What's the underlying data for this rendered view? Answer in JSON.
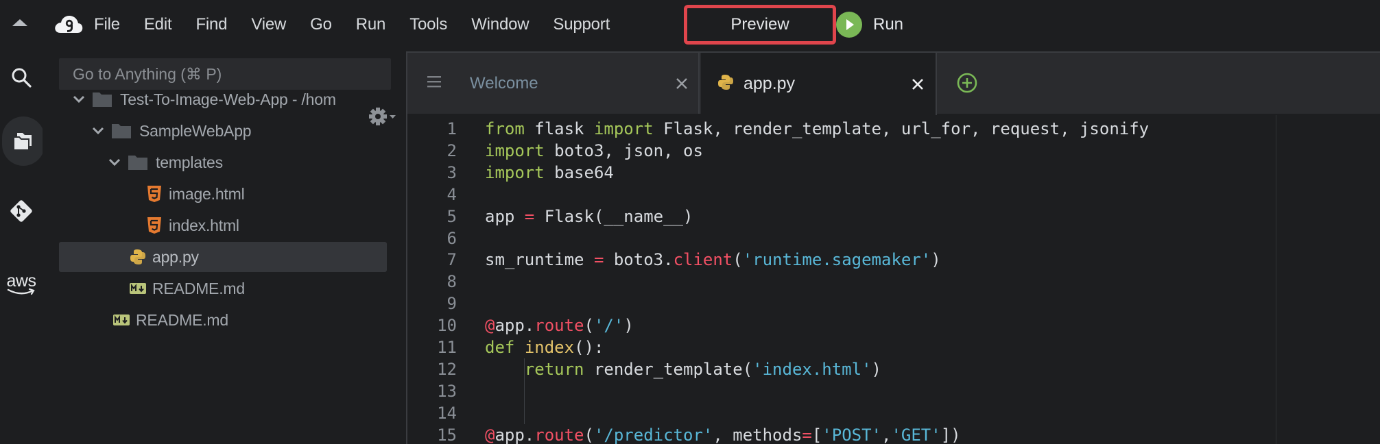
{
  "menubar": {
    "items": [
      "File",
      "Edit",
      "Find",
      "View",
      "Go",
      "Run",
      "Tools",
      "Window",
      "Support"
    ],
    "preview_label": "Preview",
    "run_label": "Run"
  },
  "rail": {
    "icons": [
      "search-icon",
      "files-icon",
      "git-icon",
      "aws-icon"
    ],
    "aws_text": "aws"
  },
  "tree": {
    "goto_placeholder": "Go to Anything (⌘ P)",
    "items": [
      {
        "label": "Test-To-Image-Web-App - /hom",
        "kind": "folder",
        "level": 0
      },
      {
        "label": "SampleWebApp",
        "kind": "folder",
        "level": 1
      },
      {
        "label": "templates",
        "kind": "folder",
        "level": 2
      },
      {
        "label": "image.html",
        "kind": "html",
        "level": 3
      },
      {
        "label": "index.html",
        "kind": "html",
        "level": 3
      },
      {
        "label": "app.py",
        "kind": "python",
        "level": 2,
        "selected": true
      },
      {
        "label": "README.md",
        "kind": "markdown",
        "level": 2
      },
      {
        "label": "README.md",
        "kind": "markdown",
        "level": 1
      }
    ]
  },
  "editor": {
    "tabs": [
      {
        "label": "Welcome",
        "active": false
      },
      {
        "label": "app.py",
        "active": true
      }
    ],
    "lines": [
      {
        "n": "1",
        "tokens": [
          [
            "kw",
            "from"
          ],
          [
            "plain",
            " flask "
          ],
          [
            "kw",
            "import"
          ],
          [
            "plain",
            " Flask, render_template, url_for, request, jsonify"
          ]
        ]
      },
      {
        "n": "2",
        "tokens": [
          [
            "kw",
            "import"
          ],
          [
            "plain",
            " boto3, json, os"
          ]
        ]
      },
      {
        "n": "3",
        "tokens": [
          [
            "kw",
            "import"
          ],
          [
            "plain",
            " base64"
          ]
        ]
      },
      {
        "n": "4",
        "tokens": []
      },
      {
        "n": "5",
        "tokens": [
          [
            "plain",
            "app "
          ],
          [
            "op",
            "="
          ],
          [
            "plain",
            " Flask(__name__)"
          ]
        ]
      },
      {
        "n": "6",
        "tokens": []
      },
      {
        "n": "7",
        "tokens": [
          [
            "plain",
            "sm_runtime "
          ],
          [
            "op",
            "="
          ],
          [
            "plain",
            " boto3."
          ],
          [
            "meth",
            "client"
          ],
          [
            "plain",
            "("
          ],
          [
            "str",
            "'runtime.sagemaker'"
          ],
          [
            "plain",
            ")"
          ]
        ]
      },
      {
        "n": "8",
        "tokens": []
      },
      {
        "n": "9",
        "tokens": []
      },
      {
        "n": "10",
        "tokens": [
          [
            "at",
            "@"
          ],
          [
            "plain",
            "app."
          ],
          [
            "meth",
            "route"
          ],
          [
            "plain",
            "("
          ],
          [
            "str",
            "'/'"
          ],
          [
            "plain",
            ")"
          ]
        ]
      },
      {
        "n": "11",
        "tokens": [
          [
            "kw",
            "def"
          ],
          [
            "plain",
            " "
          ],
          [
            "fn",
            "index"
          ],
          [
            "plain",
            "():"
          ]
        ]
      },
      {
        "n": "12",
        "tokens": [
          [
            "plain",
            "    "
          ],
          [
            "kw",
            "return"
          ],
          [
            "plain",
            " render_template("
          ],
          [
            "str",
            "'index.html'"
          ],
          [
            "plain",
            ")"
          ]
        ]
      },
      {
        "n": "13",
        "tokens": []
      },
      {
        "n": "14",
        "tokens": []
      },
      {
        "n": "15",
        "tokens": [
          [
            "at",
            "@"
          ],
          [
            "plain",
            "app."
          ],
          [
            "meth",
            "route"
          ],
          [
            "plain",
            "("
          ],
          [
            "str",
            "'/predictor'"
          ],
          [
            "plain",
            ", methods"
          ],
          [
            "op",
            "="
          ],
          [
            "plain",
            "["
          ],
          [
            "str",
            "'POST'"
          ],
          [
            "plain",
            ","
          ],
          [
            "str",
            "'GET'"
          ],
          [
            "plain",
            "])"
          ]
        ]
      }
    ]
  },
  "colors": {
    "background": "#1d1e20",
    "panel": "#2a2b2e",
    "highlight_border": "#e0454c",
    "run_green": "#7ab856",
    "keyword": "#a6c85a",
    "function": "#e4c36a",
    "decorator": "#f25064",
    "string": "#59b8d8"
  }
}
